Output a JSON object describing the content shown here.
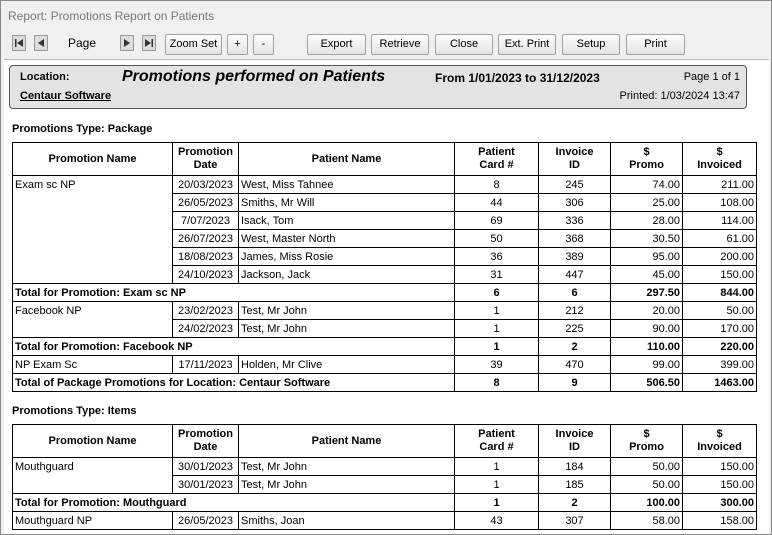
{
  "window": {
    "title": "Report: Promotions Report on Patients"
  },
  "toolbar": {
    "page_label": "Page",
    "buttons": {
      "zoom_set": "Zoom Set",
      "zoom_in": "+",
      "zoom_out": "-",
      "export": "Export",
      "retrieve": "Retrieve",
      "close": "Close",
      "ext_print": "Ext. Print",
      "setup": "Setup",
      "print": "Print"
    }
  },
  "report": {
    "location_label": "Location:",
    "title": "Promotions performed on Patients",
    "date_range": "From 1/01/2023 to 31/12/2023",
    "page_of": "Page 1 of 1",
    "location_name": "Centaur Software",
    "printed": "Printed: 1/03/2024 13:47",
    "columns": [
      "Promotion Name",
      "Promotion Date",
      "Patient Name",
      "Patient Card #",
      "Invoice ID",
      "$ Promo",
      "$ Invoiced"
    ],
    "sections": [
      {
        "type_label": "Promotions Type: Package",
        "rows": [
          {
            "name": "Exam sc NP",
            "date": "20/03/2023",
            "patient": "West, Miss Tahnee",
            "card": "8",
            "invoice": "245",
            "promo": "74.00",
            "invoiced": "211.00"
          },
          {
            "name": "",
            "date": "26/05/2023",
            "patient": "Smiths, Mr Will",
            "card": "44",
            "invoice": "306",
            "promo": "25.00",
            "invoiced": "108.00"
          },
          {
            "name": "",
            "date": "7/07/2023",
            "patient": "Isack, Tom",
            "card": "69",
            "invoice": "336",
            "promo": "28.00",
            "invoiced": "114.00"
          },
          {
            "name": "",
            "date": "26/07/2023",
            "patient": "West, Master North",
            "card": "50",
            "invoice": "368",
            "promo": "30.50",
            "invoiced": "61.00"
          },
          {
            "name": "",
            "date": "18/08/2023",
            "patient": "James, Miss Rosie",
            "card": "36",
            "invoice": "389",
            "promo": "95.00",
            "invoiced": "200.00"
          },
          {
            "name": "",
            "date": "24/10/2023",
            "patient": "Jackson, Jack",
            "card": "31",
            "invoice": "447",
            "promo": "45.00",
            "invoiced": "150.00"
          },
          {
            "total": true,
            "label": "Total for Promotion: Exam sc NP",
            "card": "6",
            "invoice": "6",
            "promo": "297.50",
            "invoiced": "844.00"
          },
          {
            "name": "Facebook NP",
            "date": "23/02/2023",
            "patient": "Test, Mr John",
            "card": "1",
            "invoice": "212",
            "promo": "20.00",
            "invoiced": "50.00"
          },
          {
            "name": "",
            "date": "24/02/2023",
            "patient": "Test, Mr John",
            "card": "1",
            "invoice": "225",
            "promo": "90.00",
            "invoiced": "170.00"
          },
          {
            "total": true,
            "label": "Total for Promotion: Facebook NP",
            "card": "1",
            "invoice": "2",
            "promo": "110.00",
            "invoiced": "220.00"
          },
          {
            "name": "NP Exam Sc",
            "date": "17/11/2023",
            "patient": "Holden, Mr Clive",
            "card": "39",
            "invoice": "470",
            "promo": "99.00",
            "invoiced": "399.00"
          },
          {
            "total": true,
            "label": "Total of Package Promotions for Location: Centaur Software",
            "card": "8",
            "invoice": "9",
            "promo": "506.50",
            "invoiced": "1463.00"
          }
        ]
      },
      {
        "type_label": "Promotions Type: Items",
        "rows": [
          {
            "name": "Mouthguard",
            "date": "30/01/2023",
            "patient": "Test, Mr John",
            "card": "1",
            "invoice": "184",
            "promo": "50.00",
            "invoiced": "150.00"
          },
          {
            "name": "",
            "date": "30/01/2023",
            "patient": "Test, Mr John",
            "card": "1",
            "invoice": "185",
            "promo": "50.00",
            "invoiced": "150.00"
          },
          {
            "total": true,
            "label": "Total for Promotion: Mouthguard",
            "card": "1",
            "invoice": "2",
            "promo": "100.00",
            "invoiced": "300.00"
          },
          {
            "name": "Mouthguard NP",
            "date": "26/05/2023",
            "patient": "Smiths, Joan",
            "card": "43",
            "invoice": "307",
            "promo": "58.00",
            "invoiced": "158.00"
          }
        ]
      }
    ]
  }
}
